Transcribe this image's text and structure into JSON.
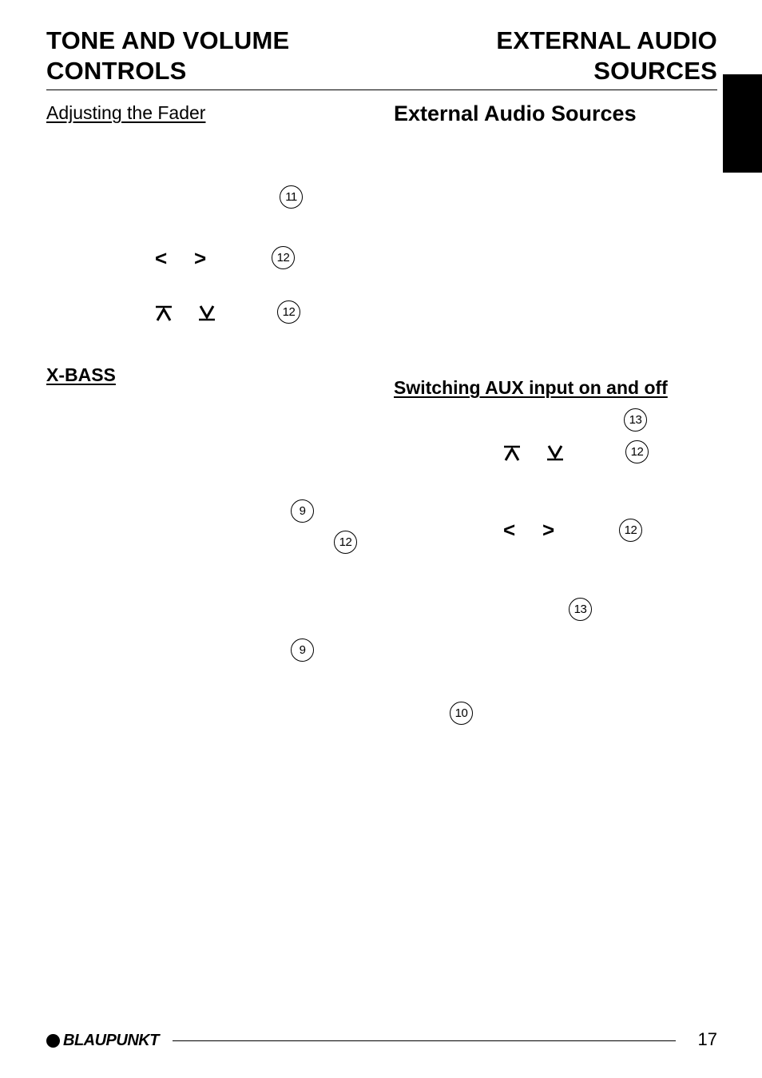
{
  "header": {
    "left_title_line1": "TONE AND VOLUME",
    "left_title_line2": "CONTROLS",
    "right_title_line1": "EXTERNAL AUDIO",
    "right_title_line2": "SOURCES"
  },
  "left_column": {
    "fader_heading": "Adjusting the Fader",
    "fader_refs": [
      "11",
      "12",
      "12"
    ],
    "xbass_heading": "X-BASS",
    "xbass_refs": [
      "9",
      "12",
      "9"
    ]
  },
  "right_column": {
    "section_heading": "External Audio Sources",
    "aux_heading": "Switching AUX input on and off",
    "aux_refs": [
      "13",
      "12",
      "12",
      "13",
      "10"
    ]
  },
  "symbols": {
    "left": "<",
    "right": ">"
  },
  "footer": {
    "brand": "BLAUPUNKT",
    "page_number": "17"
  }
}
